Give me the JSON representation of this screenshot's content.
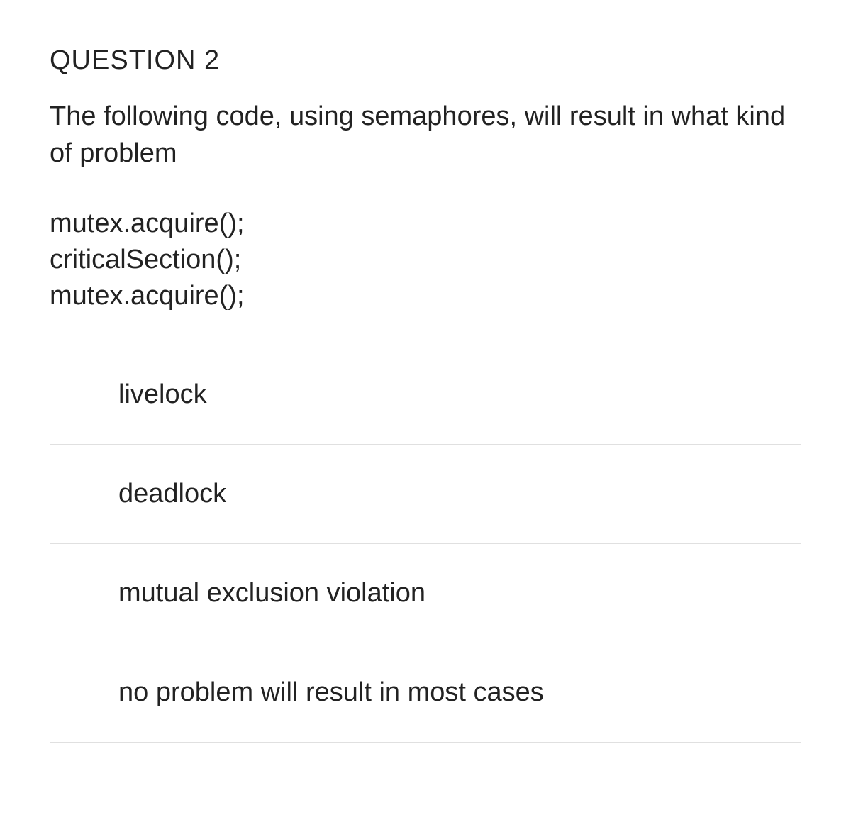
{
  "question": {
    "title": "QUESTION 2",
    "prompt": "The following code, using semaphores, will result in what kind of problem",
    "code": "mutex.acquire();\ncriticalSection();\nmutex.acquire();",
    "options": [
      {
        "label": "livelock"
      },
      {
        "label": "deadlock"
      },
      {
        "label": "mutual exclusion violation"
      },
      {
        "label": "no problem will result in most cases"
      }
    ]
  }
}
